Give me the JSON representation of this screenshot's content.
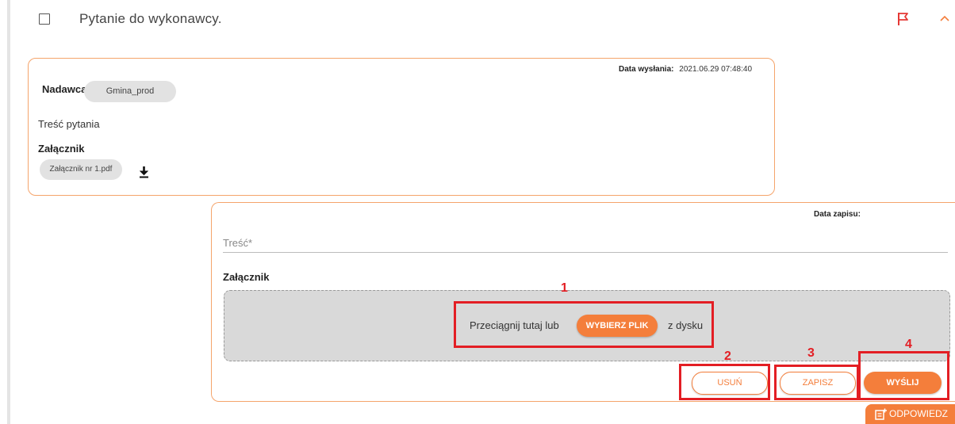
{
  "question": {
    "title": "Pytanie do wykonawcy."
  },
  "message": {
    "sender_label": "Nadawca:",
    "sender_value": "Gmina_prod",
    "sent_date_label": "Data wysłania:",
    "sent_date_value": "2021.06.29 07:48:40",
    "body": "Treść pytania",
    "attachment_label": "Załącznik",
    "attachment_file": "Załącznik nr 1.pdf"
  },
  "reply_form": {
    "save_date_label": "Data zapisu:",
    "content_placeholder": "Treść*",
    "attachment_label": "Załącznik",
    "drop_text_before": "Przeciągnij tutaj lub",
    "choose_file_button": "WYBIERZ PLIK",
    "drop_text_after": "z dysku",
    "delete_button": "USUŃ",
    "save_button": "ZAPISZ",
    "send_button": "WYŚLIJ"
  },
  "reply_button": "ODPOWIEDZ",
  "annotations": [
    "1",
    "2",
    "3",
    "4"
  ],
  "colors": {
    "accent": "#f47e3b",
    "annotation": "#e31e24",
    "flag": "#e53935"
  }
}
